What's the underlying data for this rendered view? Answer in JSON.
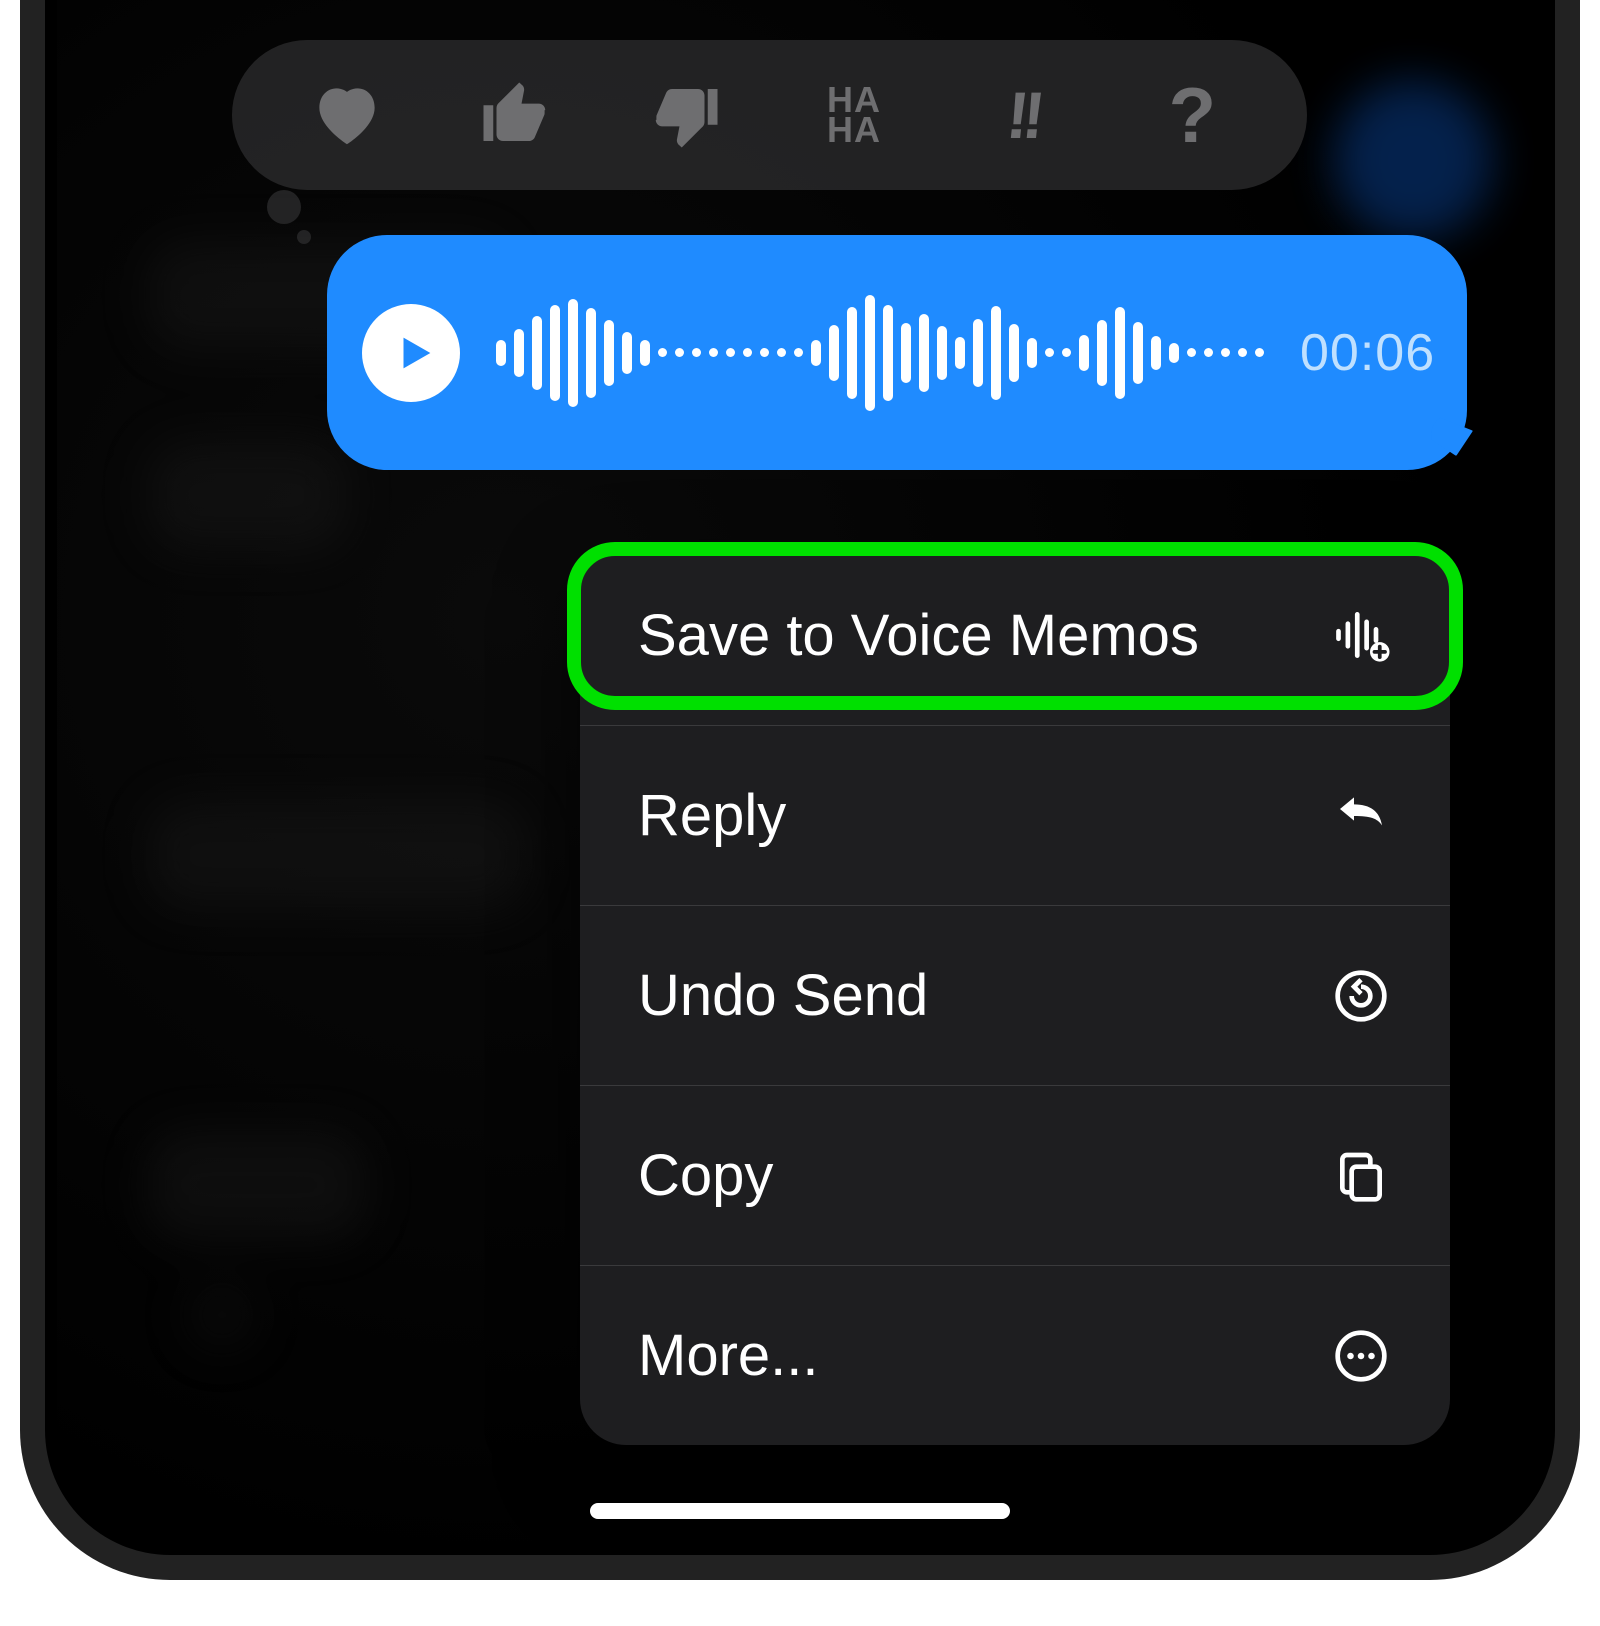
{
  "audio_message": {
    "duration": "00:06"
  },
  "tapbacks": {
    "haha_label": "HA\nHA"
  },
  "menu": {
    "items": [
      {
        "label": "Save to Voice Memos",
        "icon": "waveform-plus-icon",
        "highlighted": true
      },
      {
        "label": "Reply",
        "icon": "reply-arrow-icon"
      },
      {
        "label": "Undo Send",
        "icon": "undo-icon"
      },
      {
        "label": "Copy",
        "icon": "copy-icon"
      },
      {
        "label": "More...",
        "icon": "more-icon"
      }
    ]
  }
}
